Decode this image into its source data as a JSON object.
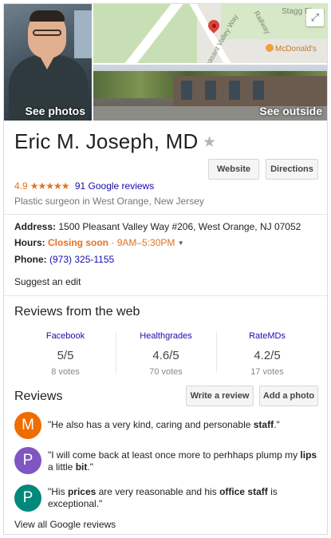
{
  "images": {
    "photos_label": "See photos",
    "outside_label": "See outside",
    "map_labels": {
      "playground": "Stagg Playg",
      "road": "Pleasant Valley Way",
      "railway": "Railway",
      "mcdonalds": "McDonald's"
    },
    "expand_icon": "⤢"
  },
  "header": {
    "name": "Eric M. Joseph, MD",
    "star_icon": "★",
    "website_label": "Website",
    "directions_label": "Directions",
    "rating": "4.9",
    "stars": "★★★★★",
    "reviews_link": "91 Google reviews",
    "category": "Plastic surgeon in West Orange, New Jersey"
  },
  "info": {
    "address_label": "Address:",
    "address": "1500 Pleasant Valley Way #206, West Orange, NJ 07052",
    "hours_label": "Hours:",
    "hours_status": "Closing soon",
    "hours_sep": " · ",
    "hours_value": "9AM–5:30PM",
    "hours_caret": "▼",
    "phone_label": "Phone:",
    "phone": "(973) 325-1155",
    "suggest_edit": "Suggest an edit"
  },
  "web_reviews": {
    "heading": "Reviews from the web",
    "sources": [
      {
        "name": "Facebook",
        "score": "5/5",
        "votes": "8 votes"
      },
      {
        "name": "Healthgrades",
        "score": "4.6/5",
        "votes": "70 votes"
      },
      {
        "name": "RateMDs",
        "score": "4.2/5",
        "votes": "17 votes"
      }
    ]
  },
  "reviews": {
    "heading": "Reviews",
    "write_label": "Write a review",
    "photo_label": "Add a photo",
    "items": [
      {
        "initial": "M",
        "color": "#ef6c00",
        "parts": [
          "\"He also has a very kind, caring and personable ",
          "staff",
          ".\""
        ]
      },
      {
        "initial": "P",
        "color": "#7e57c2",
        "parts": [
          "\"I will come back at least once more to perhhaps plump my ",
          "lips",
          " a little ",
          "bit",
          ".\""
        ]
      },
      {
        "initial": "P",
        "color": "#00897b",
        "parts": [
          "\"His ",
          "prices",
          " are very reasonable and his ",
          "office staff",
          " is exceptional.\""
        ]
      }
    ],
    "view_all": "View all Google reviews"
  }
}
